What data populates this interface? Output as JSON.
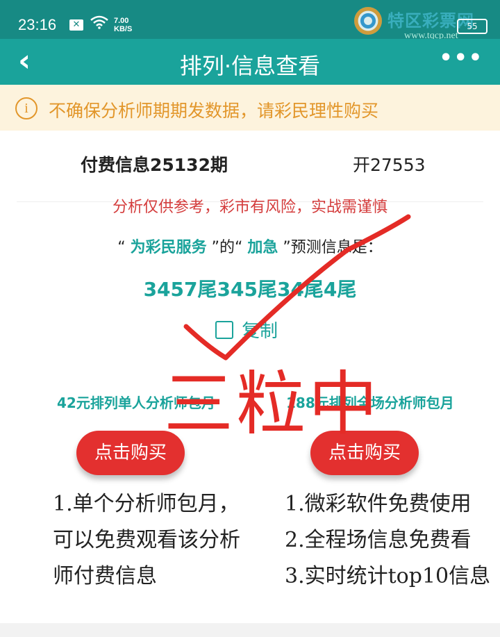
{
  "status_bar": {
    "time": "23:16",
    "x_badge": "✕",
    "wifi_icon": "wifi-icon",
    "speed_value": "7.00",
    "speed_unit": "KB/S",
    "battery": "55"
  },
  "watermark": {
    "text": "特区彩票网",
    "url": "www.tqcp.net"
  },
  "nav": {
    "back_icon": "‹",
    "title": "排列·信息查看",
    "more_icon": "•••"
  },
  "notice": {
    "icon": "i",
    "text": "不确保分析师期期发数据，请彩民理性购买"
  },
  "info": {
    "period": "付费信息25132期",
    "open_result": "开27553",
    "risk_note": "分析仅供参考，彩市有风险，实战需谨慎",
    "quote_open": "“ ",
    "analyst_name": "为彩民服务",
    "quote_mid": " ”的“ ",
    "plan_name": "加急",
    "quote_close": " ”预测信息是：",
    "numbers": "3457尾345尾34尾4尾",
    "copy_label": "复制"
  },
  "plans": {
    "left_title": "42元排列单人分析师包月",
    "right_title": "188元排列全场分析师包月",
    "buy_label": "点击购买",
    "left_desc": [
      "1.单个分析师包月，",
      "可以免费观看该分析",
      "师付费信息"
    ],
    "right_desc": [
      "1.微彩软件免费使用",
      "2.全程场信息免费看",
      "3.实时统计top10信息"
    ]
  },
  "overlay": {
    "text": "三粒中",
    "color": "#e42b26"
  },
  "colors": {
    "teal": "#1aa39b",
    "status_teal": "#178a84",
    "notice_bg": "#fdf3dd",
    "notice_fg": "#e2962a",
    "button_red": "#e3302f"
  }
}
